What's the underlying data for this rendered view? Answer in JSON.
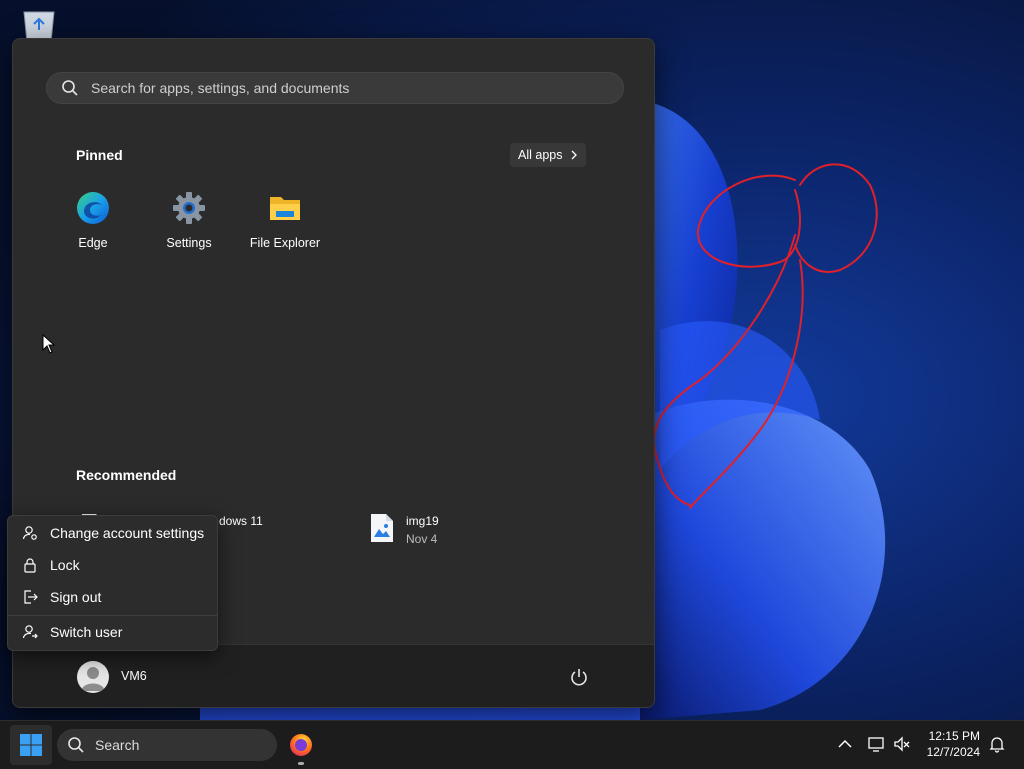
{
  "start_menu": {
    "search": {
      "placeholder": "Search for apps, settings, and documents"
    },
    "pinned": {
      "title": "Pinned",
      "all_apps_label": "All apps",
      "apps": [
        {
          "label": "Edge",
          "icon": "edge-icon"
        },
        {
          "label": "Settings",
          "icon": "gear-icon"
        },
        {
          "label": "File Explorer",
          "icon": "folder-icon"
        }
      ]
    },
    "recommended": {
      "title": "Recommended",
      "items": [
        {
          "title": "dows 11",
          "subtitle": ""
        },
        {
          "title": "img19",
          "subtitle": "Nov 4"
        }
      ]
    },
    "footer": {
      "username": "VM6"
    }
  },
  "account_menu": {
    "items": [
      {
        "label": "Change account settings",
        "icon": "account-settings-icon"
      },
      {
        "label": "Lock",
        "icon": "lock-icon"
      },
      {
        "label": "Sign out",
        "icon": "sign-out-icon"
      },
      {
        "label": "Switch user",
        "icon": "switch-user-icon"
      }
    ]
  },
  "taskbar": {
    "search_label": "Search",
    "clock": {
      "time": "12:15 PM",
      "date": "12/7/2024"
    }
  },
  "colors": {
    "accent": "#0078d4",
    "menu_bg": "#2b2b2b",
    "annotation": "#e0202a"
  }
}
